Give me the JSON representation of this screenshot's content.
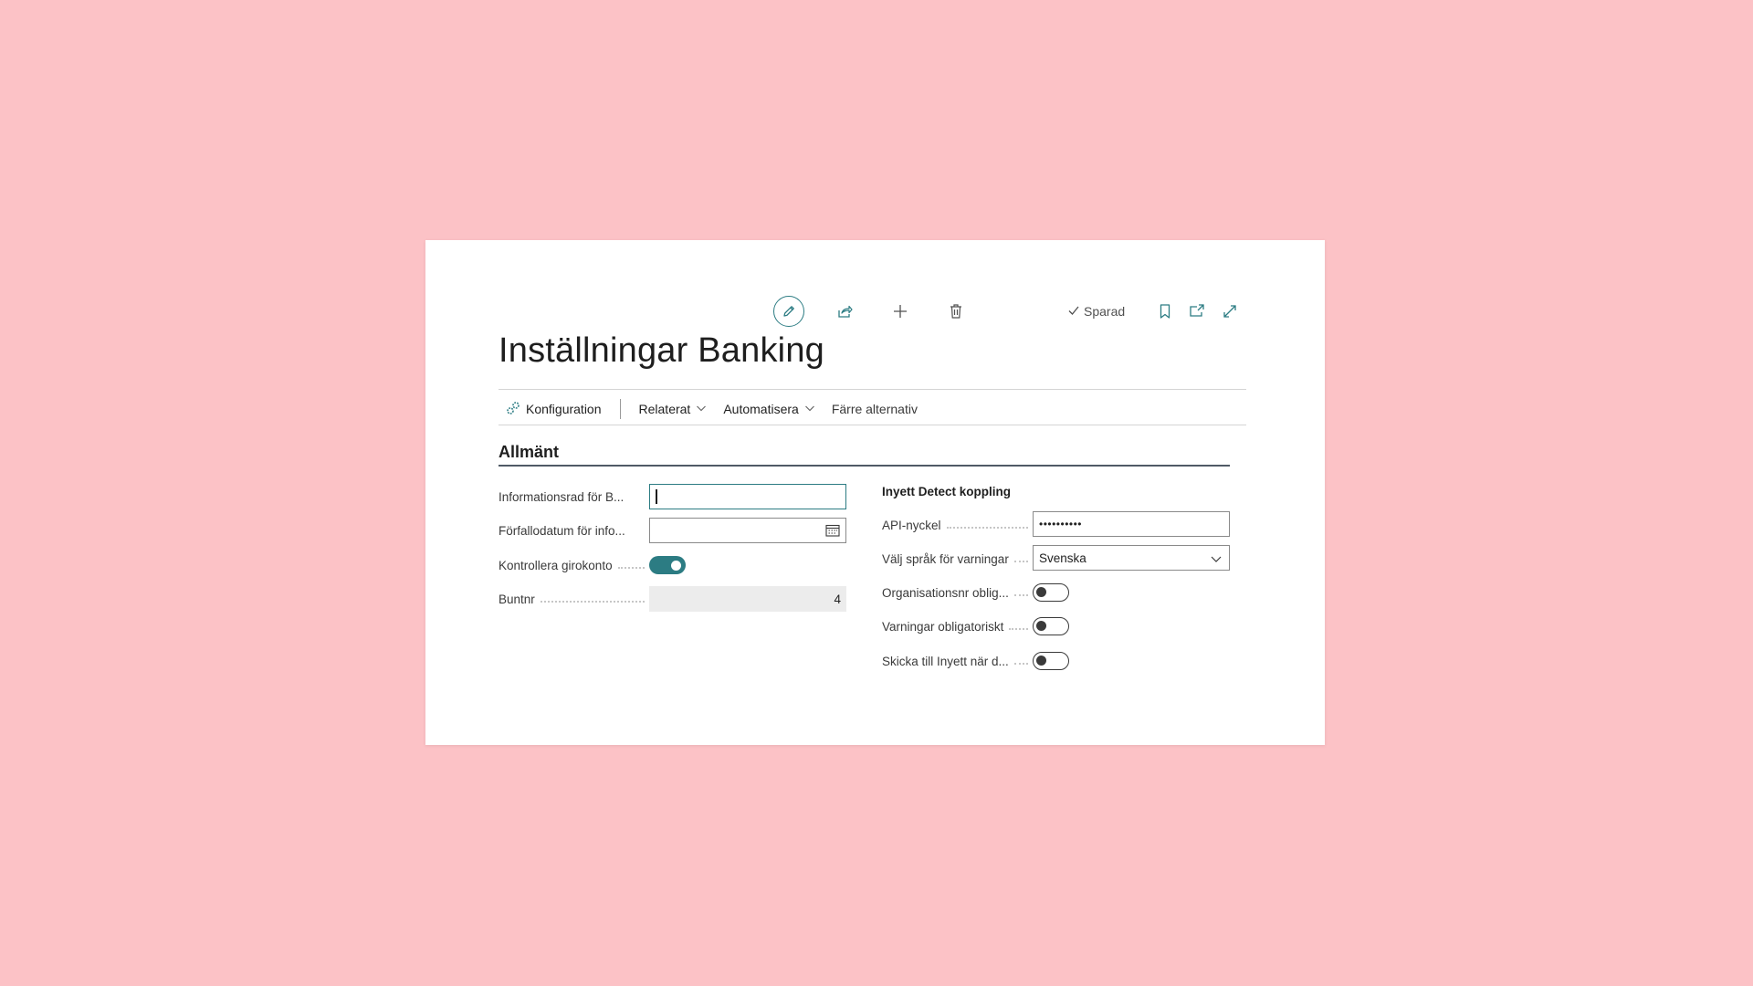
{
  "toolbar": {
    "edit_icon": "pencil-icon",
    "share_icon": "share-icon",
    "new_icon": "plus-icon",
    "delete_icon": "trash-icon",
    "saved_label": "Sparad",
    "bookmark_icon": "bookmark-icon",
    "open_new_window_icon": "open-in-new-window-icon",
    "expand_icon": "expand-icon"
  },
  "page": {
    "title": "Inställningar Banking"
  },
  "actions": {
    "konfiguration": "Konfiguration",
    "relaterat": "Relaterat",
    "automatisera": "Automatisera",
    "farre_alternativ": "Färre alternativ"
  },
  "section": {
    "title": "Allmänt"
  },
  "left_fields": {
    "info_label": "Informationsrad för B...",
    "info_value": "",
    "due_label": "Förfallodatum för info...",
    "due_value": "",
    "girokonto_label": "Kontrollera girokonto",
    "girokonto_on": true,
    "buntnr_label": "Buntnr",
    "buntnr_value": "4"
  },
  "right_fields": {
    "group_title": "Inyett Detect koppling",
    "api_label": "API-nyckel",
    "api_value": "••••••••••",
    "language_label": "Välj språk för varningar",
    "language_value": "Svenska",
    "orgnr_label": "Organisationsnr oblig...",
    "orgnr_on": false,
    "warnings_label": "Varningar obligatoriskt",
    "warnings_on": false,
    "send_label": "Skicka till Inyett när d...",
    "send_on": false
  },
  "colors": {
    "background": "#fcc2c6",
    "accent": "#2c7c83"
  }
}
